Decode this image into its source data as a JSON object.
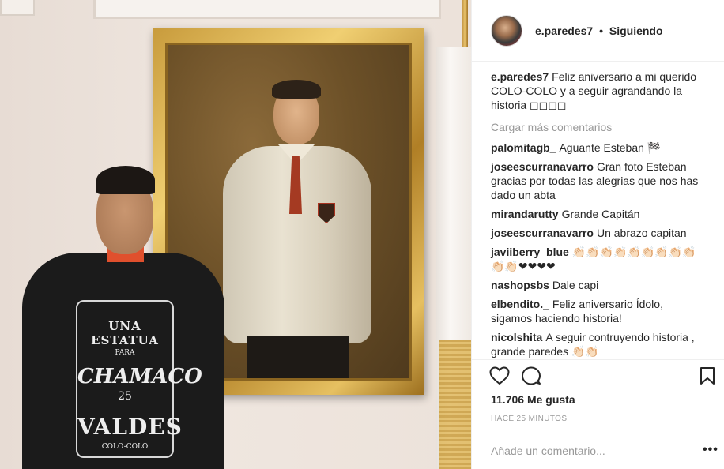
{
  "post": {
    "username": "e.paredes7",
    "separator": "•",
    "follow_status": "Siguiendo",
    "caption": "Feliz aniversario a mi querido COLO-COLO y a seguir agrandando la historia ◻◻◻◻"
  },
  "shirt_print": {
    "line1": "UNA ESTATUA",
    "line2": "PARA",
    "line3": "CHAMACO",
    "line4": "25",
    "line5": "VALDES",
    "line6": "COLO-COLO"
  },
  "load_more_label": "Cargar más comentarios",
  "comments": [
    {
      "user": "palomitagb_",
      "text": "Aguante Esteban 🏁"
    },
    {
      "user": "joseescurranavarro",
      "text": "Gran foto Esteban gracias por todas las alegrias que nos has dado un abta"
    },
    {
      "user": "mirandarutty",
      "text": "Grande Capitán"
    },
    {
      "user": "joseescurranavarro",
      "text": "Un abrazo capitan"
    },
    {
      "user": "javiiberry_blue",
      "text": "👏🏻👏🏻👏🏻👏🏻👏🏻👏🏻👏🏻👏🏻👏🏻👏🏻👏🏻❤❤❤❤"
    },
    {
      "user": "nashopsbs",
      "text": "Dale capi"
    },
    {
      "user": "elbendito._",
      "text": "Feliz aniversario Ídolo, sigamos haciendo historia!"
    },
    {
      "user": "nicolshita",
      "text": "A seguir contruyendo historia , grande paredes 👏🏻👏🏻"
    }
  ],
  "actions": {
    "like_icon": "heart-icon",
    "comment_icon": "comment-bubble-icon",
    "save_icon": "bookmark-icon"
  },
  "likes_label": "11.706 Me gusta",
  "time_ago": "HACE 25 MINUTOS",
  "add_comment_placeholder": "Añade un comentario...",
  "more_options": "•••"
}
